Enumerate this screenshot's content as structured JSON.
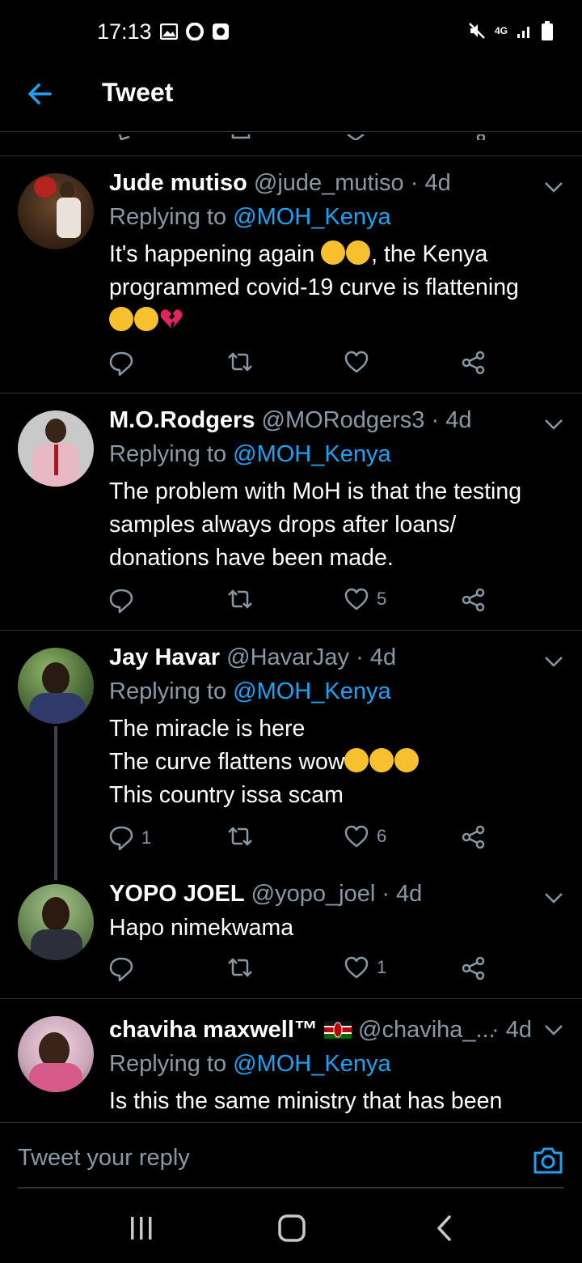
{
  "status_bar": {
    "time": "17:13",
    "network": "4G"
  },
  "header": {
    "title": "Tweet"
  },
  "tweets": [
    {
      "name": "Jude mutiso",
      "handle": "@jude_mutiso",
      "time": "· 4d",
      "replying_prefix": "Replying to",
      "replying_handle": "@MOH_Kenya",
      "lines": [
        "It's happening again",
        ", the Kenya",
        "programmed covid-19 curve is flattening"
      ],
      "replies": "",
      "retweets": "",
      "likes": ""
    },
    {
      "name": "M.O.Rodgers",
      "handle": "@MORodgers3",
      "time": "· 4d",
      "replying_prefix": "Replying to",
      "replying_handle": "@MOH_Kenya",
      "lines": [
        "The problem with MoH is that the testing",
        "samples always drops after loans/",
        "donations have been made."
      ],
      "replies": "",
      "retweets": "",
      "likes": "5"
    },
    {
      "name": "Jay Havar",
      "handle": "@HavarJay",
      "time": "· 4d",
      "replying_prefix": "Replying to",
      "replying_handle": "@MOH_Kenya",
      "lines": [
        "The miracle is here",
        "The curve flattens wow",
        "This country issa scam"
      ],
      "replies": "1",
      "retweets": "",
      "likes": "6"
    },
    {
      "name": "YOPO JOEL",
      "handle": "@yopo_joel",
      "time": "· 4d",
      "lines": [
        "Hapo nimekwama"
      ],
      "replies": "",
      "retweets": "",
      "likes": "1"
    },
    {
      "name": "chaviha maxwell™",
      "handle": "@chaviha_...",
      "time": "· 4d",
      "replying_prefix": "Replying to",
      "replying_handle": "@MOH_Kenya",
      "lines": [
        "Is this the same ministry that has been"
      ]
    }
  ],
  "reply_bar": {
    "placeholder": "Tweet your reply"
  },
  "colors": {
    "background": "#000000",
    "accent": "#1da1f2",
    "muted": "#8899a6",
    "divider": "#2f3336"
  },
  "icons": [
    "back-arrow-icon",
    "chevron-down-icon",
    "reply-icon",
    "retweet-icon",
    "like-icon",
    "share-icon",
    "camera-icon"
  ]
}
